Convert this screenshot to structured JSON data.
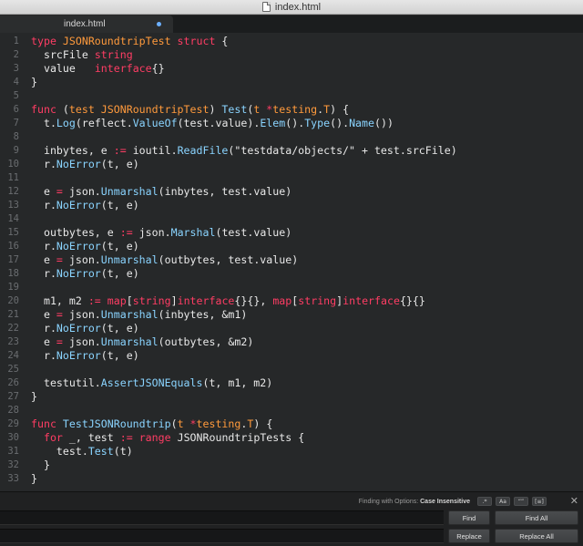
{
  "window": {
    "title": "index.html"
  },
  "tab": {
    "label": "index.html"
  },
  "code": {
    "lines": [
      {
        "n": "1",
        "tokens": [
          [
            "kw",
            "type "
          ],
          [
            "ty",
            "JSONRoundtripTest "
          ],
          [
            "kw",
            "struct"
          ],
          [
            "pl",
            " {"
          ]
        ]
      },
      {
        "n": "2",
        "tokens": [
          [
            "pl",
            "  srcFile "
          ],
          [
            "kw",
            "string"
          ]
        ]
      },
      {
        "n": "3",
        "tokens": [
          [
            "pl",
            "  value   "
          ],
          [
            "kw",
            "interface"
          ],
          [
            "pl",
            "{}"
          ]
        ]
      },
      {
        "n": "4",
        "tokens": [
          [
            "pl",
            "}"
          ]
        ]
      },
      {
        "n": "5",
        "tokens": []
      },
      {
        "n": "6",
        "tokens": [
          [
            "kw",
            "func"
          ],
          [
            "pl",
            " ("
          ],
          [
            "ty",
            "test JSONRoundtripTest"
          ],
          [
            "pl",
            ") "
          ],
          [
            "fn",
            "Test"
          ],
          [
            "pl",
            "("
          ],
          [
            "ty",
            "t "
          ],
          [
            "kw",
            "*"
          ],
          [
            "ty",
            "testing"
          ],
          [
            "pl",
            "."
          ],
          [
            "ty",
            "T"
          ],
          [
            "pl",
            ") {"
          ]
        ]
      },
      {
        "n": "7",
        "tokens": [
          [
            "pl",
            "  t."
          ],
          [
            "fn",
            "Log"
          ],
          [
            "pl",
            "(reflect."
          ],
          [
            "fn",
            "ValueOf"
          ],
          [
            "pl",
            "(test.value)."
          ],
          [
            "fn",
            "Elem"
          ],
          [
            "pl",
            "()."
          ],
          [
            "fn",
            "Type"
          ],
          [
            "pl",
            "()."
          ],
          [
            "fn",
            "Name"
          ],
          [
            "pl",
            "())"
          ]
        ]
      },
      {
        "n": "8",
        "tokens": []
      },
      {
        "n": "9",
        "tokens": [
          [
            "pl",
            "  inbytes, e "
          ],
          [
            "kw",
            ":="
          ],
          [
            "pl",
            " ioutil."
          ],
          [
            "fn",
            "ReadFile"
          ],
          [
            "pl",
            "(\"testdata/objects/\" + test.srcFile)"
          ]
        ]
      },
      {
        "n": "10",
        "tokens": [
          [
            "pl",
            "  r."
          ],
          [
            "fn",
            "NoError"
          ],
          [
            "pl",
            "(t, e)"
          ]
        ]
      },
      {
        "n": "11",
        "tokens": []
      },
      {
        "n": "12",
        "tokens": [
          [
            "pl",
            "  e "
          ],
          [
            "kw",
            "="
          ],
          [
            "pl",
            " json."
          ],
          [
            "fn",
            "Unmarshal"
          ],
          [
            "pl",
            "(inbytes, test.value)"
          ]
        ]
      },
      {
        "n": "13",
        "tokens": [
          [
            "pl",
            "  r."
          ],
          [
            "fn",
            "NoError"
          ],
          [
            "pl",
            "(t, e)"
          ]
        ]
      },
      {
        "n": "14",
        "tokens": []
      },
      {
        "n": "15",
        "tokens": [
          [
            "pl",
            "  outbytes, e "
          ],
          [
            "kw",
            ":="
          ],
          [
            "pl",
            " json."
          ],
          [
            "fn",
            "Marshal"
          ],
          [
            "pl",
            "(test.value)"
          ]
        ]
      },
      {
        "n": "16",
        "tokens": [
          [
            "pl",
            "  r."
          ],
          [
            "fn",
            "NoError"
          ],
          [
            "pl",
            "(t, e)"
          ]
        ]
      },
      {
        "n": "17",
        "tokens": [
          [
            "pl",
            "  e "
          ],
          [
            "kw",
            "="
          ],
          [
            "pl",
            " json."
          ],
          [
            "fn",
            "Unmarshal"
          ],
          [
            "pl",
            "(outbytes, test.value)"
          ]
        ]
      },
      {
        "n": "18",
        "tokens": [
          [
            "pl",
            "  r."
          ],
          [
            "fn",
            "NoError"
          ],
          [
            "pl",
            "(t, e)"
          ]
        ]
      },
      {
        "n": "19",
        "tokens": []
      },
      {
        "n": "20",
        "tokens": [
          [
            "pl",
            "  m1, m2 "
          ],
          [
            "kw",
            ":="
          ],
          [
            "pl",
            " "
          ],
          [
            "kw",
            "map"
          ],
          [
            "pl",
            "["
          ],
          [
            "kw",
            "string"
          ],
          [
            "pl",
            "]"
          ],
          [
            "kw",
            "interface"
          ],
          [
            "pl",
            "{}{}, "
          ],
          [
            "kw",
            "map"
          ],
          [
            "pl",
            "["
          ],
          [
            "kw",
            "string"
          ],
          [
            "pl",
            "]"
          ],
          [
            "kw",
            "interface"
          ],
          [
            "pl",
            "{}{}"
          ]
        ]
      },
      {
        "n": "21",
        "tokens": [
          [
            "pl",
            "  e "
          ],
          [
            "kw",
            "="
          ],
          [
            "pl",
            " json."
          ],
          [
            "fn",
            "Unmarshal"
          ],
          [
            "pl",
            "(inbytes, &m1)"
          ]
        ]
      },
      {
        "n": "22",
        "tokens": [
          [
            "pl",
            "  r."
          ],
          [
            "fn",
            "NoError"
          ],
          [
            "pl",
            "(t, e)"
          ]
        ]
      },
      {
        "n": "23",
        "tokens": [
          [
            "pl",
            "  e "
          ],
          [
            "kw",
            "="
          ],
          [
            "pl",
            " json."
          ],
          [
            "fn",
            "Unmarshal"
          ],
          [
            "pl",
            "(outbytes, &m2)"
          ]
        ]
      },
      {
        "n": "24",
        "tokens": [
          [
            "pl",
            "  r."
          ],
          [
            "fn",
            "NoError"
          ],
          [
            "pl",
            "(t, e)"
          ]
        ]
      },
      {
        "n": "25",
        "tokens": []
      },
      {
        "n": "26",
        "tokens": [
          [
            "pl",
            "  testutil."
          ],
          [
            "fn",
            "AssertJSONEquals"
          ],
          [
            "pl",
            "(t, m1, m2)"
          ]
        ]
      },
      {
        "n": "27",
        "tokens": [
          [
            "pl",
            "}"
          ]
        ]
      },
      {
        "n": "28",
        "tokens": []
      },
      {
        "n": "29",
        "tokens": [
          [
            "kw",
            "func"
          ],
          [
            "pl",
            " "
          ],
          [
            "fn",
            "TestJSONRoundtrip"
          ],
          [
            "pl",
            "("
          ],
          [
            "ty",
            "t "
          ],
          [
            "kw",
            "*"
          ],
          [
            "ty",
            "testing"
          ],
          [
            "pl",
            "."
          ],
          [
            "ty",
            "T"
          ],
          [
            "pl",
            ") {"
          ]
        ]
      },
      {
        "n": "30",
        "tokens": [
          [
            "pl",
            "  "
          ],
          [
            "kw",
            "for"
          ],
          [
            "pl",
            " _, test "
          ],
          [
            "kw",
            ":="
          ],
          [
            "pl",
            " "
          ],
          [
            "kw",
            "range"
          ],
          [
            "pl",
            " JSONRoundtripTests {"
          ]
        ]
      },
      {
        "n": "31",
        "tokens": [
          [
            "pl",
            "    test."
          ],
          [
            "fn",
            "Test"
          ],
          [
            "pl",
            "(t)"
          ]
        ]
      },
      {
        "n": "32",
        "tokens": [
          [
            "pl",
            "  }"
          ]
        ]
      },
      {
        "n": "33",
        "tokens": [
          [
            "pl",
            "}"
          ]
        ]
      }
    ]
  },
  "find_panel": {
    "options_prefix": "Finding with Options:",
    "options_value": "Case Insensitive",
    "option_buttons": [
      ".*",
      "Aa",
      "“”",
      "[≡]"
    ],
    "close_glyph": "✕",
    "find_label": "Find",
    "find_all_label": "Find All",
    "replace_label": "Replace",
    "replace_all_label": "Replace All",
    "find_value": "",
    "replace_value": ""
  },
  "colors": {
    "keyword": "#ff3d64",
    "type": "#ff9a3c",
    "function": "#8ad4ff",
    "plain": "#e8e8e8",
    "editor_bg": "#262829",
    "modified_dot": "#6cb0ff"
  }
}
